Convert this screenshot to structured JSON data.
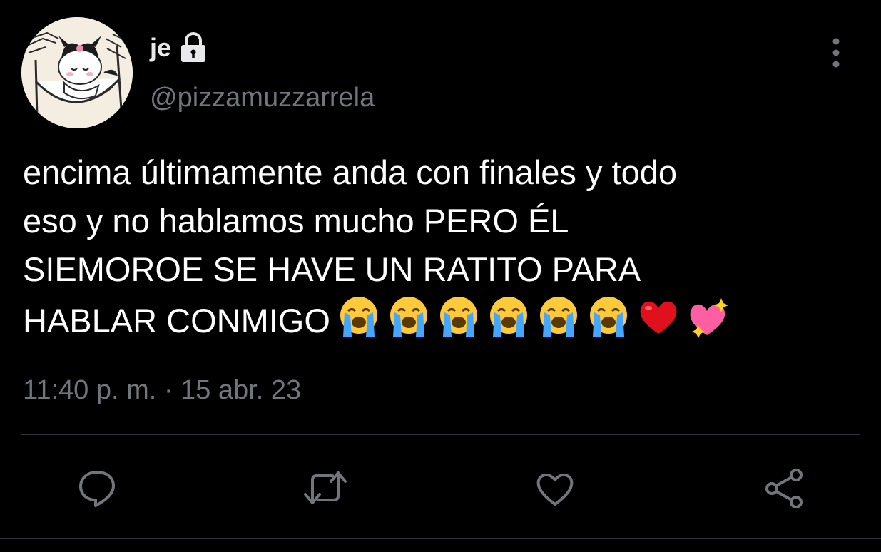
{
  "user": {
    "display_name": "je",
    "handle": "@pizzamuzzarrela",
    "protected": true
  },
  "tweet": {
    "text": "encima últimamente anda con finales y todo\neso y no hablamos mucho PERO ÉL\nSIEMOROE SE HAVE UN RATITO PARA\nHABLAR CONMIGO",
    "emojis": [
      "loudly-crying-face",
      "loudly-crying-face",
      "loudly-crying-face",
      "loudly-crying-face",
      "loudly-crying-face",
      "loudly-crying-face",
      "red-heart",
      "sparkling-heart"
    ],
    "timestamp": "11:40 p. m. · 15 abr. 23"
  },
  "actions": [
    "reply",
    "retweet",
    "like",
    "share"
  ],
  "colors": {
    "background": "#000000",
    "text": "#ffffff",
    "secondary": "#71767b",
    "divider": "#2f3336",
    "icon": "#71767b"
  }
}
